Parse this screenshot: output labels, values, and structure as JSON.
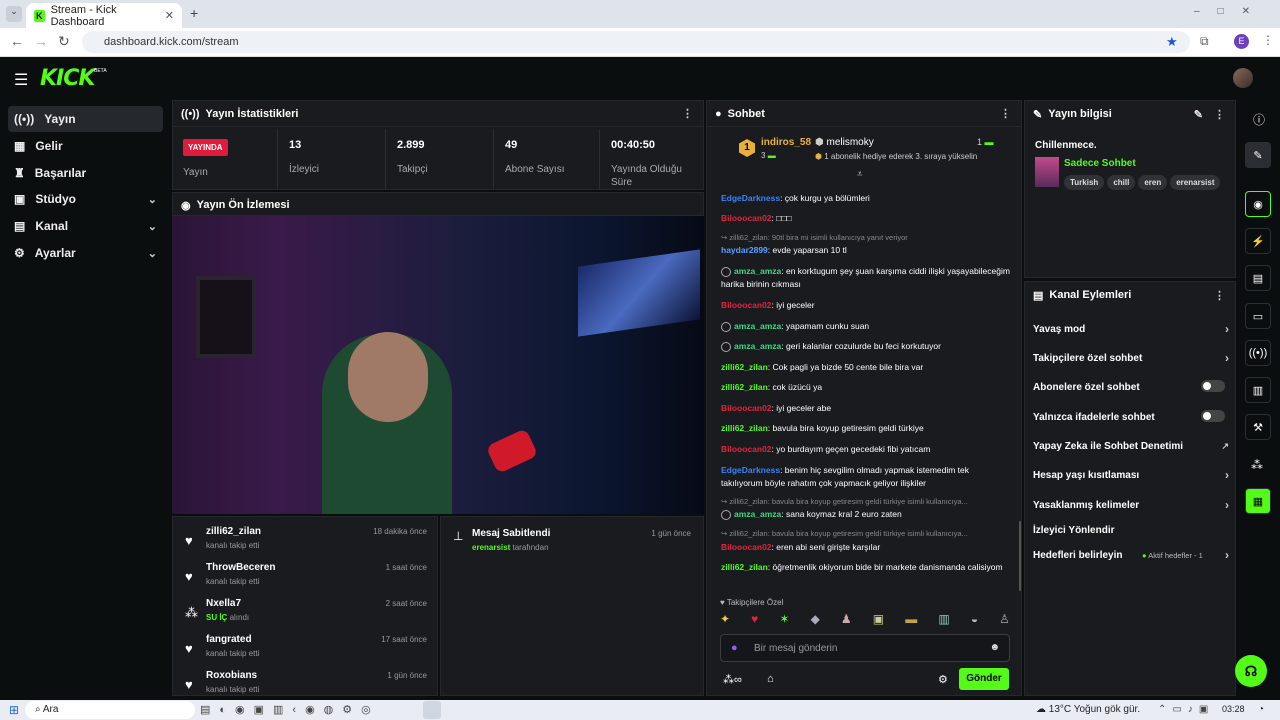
{
  "browser": {
    "tab_title": "Stream - Kick Dashboard",
    "url": "dashboard.kick.com/stream",
    "profile_initial": "E"
  },
  "app": {
    "logo": "KICK",
    "beta": "BETA"
  },
  "sidebar": {
    "items": [
      {
        "label": "Yayın",
        "icon": "broadcast-icon"
      },
      {
        "label": "Gelir",
        "icon": "money-icon"
      },
      {
        "label": "Başarılar",
        "icon": "trophy-icon"
      },
      {
        "label": "Stüdyo",
        "icon": "studio-icon"
      },
      {
        "label": "Kanal",
        "icon": "channel-icon"
      },
      {
        "label": "Ayarlar",
        "icon": "gear-icon"
      }
    ]
  },
  "stats": {
    "title": "Yayın İstatistikleri",
    "live_badge": "YAYINDA",
    "live_label": "Yayın",
    "items": [
      {
        "value": "13",
        "label": "İzleyici"
      },
      {
        "value": "2.899",
        "label": "Takipçi"
      },
      {
        "value": "49",
        "label": "Abone Sayısı"
      },
      {
        "value": "00:40:50",
        "label": "Yayında Olduğu Süre"
      }
    ]
  },
  "preview": {
    "title": "Yayın Ön İzlemesi"
  },
  "activity": [
    {
      "name": "zilli62_zilan",
      "sub": "kanalı takip etti",
      "time": "18 dakika önce",
      "icon": "heart-icon"
    },
    {
      "name": "ThrowBeceren",
      "sub": "kanalı takip etti",
      "time": "1 saat önce",
      "icon": "heart-icon"
    },
    {
      "name": "Nxella7",
      "sub_green": "SU İÇ",
      "sub": "alındı",
      "time": "2 saat önce",
      "icon": "dots-icon"
    },
    {
      "name": "fangrated",
      "sub": "kanalı takip etti",
      "time": "17 saat önce",
      "icon": "heart-icon"
    },
    {
      "name": "Roxobians",
      "sub": "kanalı takip etti",
      "time": "1 gün önce",
      "icon": "heart-icon"
    }
  ],
  "pinned": {
    "title": "Mesaj Sabitlendi",
    "time": "1 gün önce",
    "by_user": "erenarsist",
    "by_suffix": "tarafından"
  },
  "chat": {
    "title": "Sohbet",
    "top_gifter": {
      "rank": "1",
      "name": "indiros_58",
      "count": "3"
    },
    "gift_user": {
      "name": "melismoky",
      "count": "1",
      "text": "1 abonelik hediye ederek 3. sıraya yükselin"
    },
    "messages": [
      {
        "user": "EdgeDarkness",
        "color": "#3b82f6",
        "text": ": çok kurgu ya bölümleri"
      },
      {
        "user": "Bilooocan02",
        "color": "#e0243d",
        "text": ": □□□"
      },
      {
        "reply": "zilli62_zilan: 90tl bira mi isimli kullanıcıya yanıt veriyor",
        "user": "haydar2899",
        "color": "#5aa0ff",
        "text": ": evde yaparsan 10 tl"
      },
      {
        "user": "amza_amza",
        "color": "#3ddc84",
        "badge": true,
        "text": ": en korktugum şey şuan karşıma ciddi ilişki yaşayabileceğim harika birinin cıkması"
      },
      {
        "user": "Bilooocan02",
        "color": "#e0243d",
        "text": ": iyi geceler"
      },
      {
        "user": "amza_amza",
        "color": "#3ddc84",
        "badge": true,
        "text": ": yapamam cunku suan"
      },
      {
        "user": "amza_amza",
        "color": "#3ddc84",
        "badge": true,
        "text": ": geri kalanlar cozulurde bu feci korkutuyor"
      },
      {
        "user": "zilli62_zilan",
        "color": "#53fc18",
        "text": ": Cok pagli ya bizde 50 cente bile bira var"
      },
      {
        "user": "zilli62_zilan",
        "color": "#53fc18",
        "text": ": cok üzücü ya"
      },
      {
        "user": "Bilooocan02",
        "color": "#e0243d",
        "text": ": iyi geceler abe"
      },
      {
        "user": "zilli62_zilan",
        "color": "#53fc18",
        "text": ": bavula bira koyup getiresim geldi türkiye"
      },
      {
        "user": "Bilooocan02",
        "color": "#e0243d",
        "text": ": yo burdayım geçen gecedeki fibi yatıcam"
      },
      {
        "user": "EdgeDarkness",
        "color": "#3b82f6",
        "text": ": benim hiç sevgilim olmadı yapmak istemedim tek takılıyorum böyle rahatım çok yapmacık geliyor ilişkiler"
      },
      {
        "reply": "zilli62_zilan: bavula bira koyup getiresim geldi türkiye isimli kullanıcıya...",
        "user": "amza_amza",
        "color": "#3ddc84",
        "badge": true,
        "text": ": sana koymaz kral 2 euro zaten"
      },
      {
        "reply": "zilli62_zilan: bavula bira koyup getiresim geldi türkiye isimli kullanıcıya...",
        "user": "Bilooocan02",
        "color": "#e0243d",
        "text": ": eren abi seni girişte karşılar"
      },
      {
        "user": "zilli62_zilan",
        "color": "#53fc18",
        "text": ": öğretmenlik okiyorum bide bir markete danismanda calisiyom"
      }
    ],
    "emote_label": "Takipçilere Özel",
    "input_placeholder": "Bir mesaj gönderin",
    "send_label": "Gönder"
  },
  "stream_info": {
    "title": "Yayın bilgisi",
    "stream_title": "Chillenmece.",
    "category": "Sadece Sohbet",
    "tags": [
      "Turkish",
      "chill",
      "eren",
      "erenarsist"
    ]
  },
  "channel_actions": {
    "title": "Kanal Eylemleri",
    "items": [
      {
        "label": "Yavaş mod",
        "kind": "chevron"
      },
      {
        "label": "Takipçilere özel sohbet",
        "kind": "chevron"
      },
      {
        "label": "Abonelere özel sohbet",
        "kind": "toggle"
      },
      {
        "label": "Yalnızca ifadelerle sohbet",
        "kind": "toggle"
      },
      {
        "label": "Yapay Zeka ile Sohbet Denetimi",
        "kind": "external"
      },
      {
        "label": "Hesap yaşı kısıtlaması",
        "kind": "chevron"
      },
      {
        "label": "Yasaklanmış kelimeler",
        "kind": "chevron"
      },
      {
        "label": "İzleyici Yönlendir",
        "kind": "none"
      },
      {
        "label": "Hedefleri belirleyin",
        "kind": "chevron",
        "extra": "Aktif hedefler - 1"
      }
    ]
  },
  "taskbar": {
    "search": "Ara",
    "weather": "13°C",
    "weather_text": "Yoğun gök gür.",
    "time": "03:28"
  },
  "colors": {
    "accent": "#53fc18",
    "live": "#e01b3c"
  }
}
